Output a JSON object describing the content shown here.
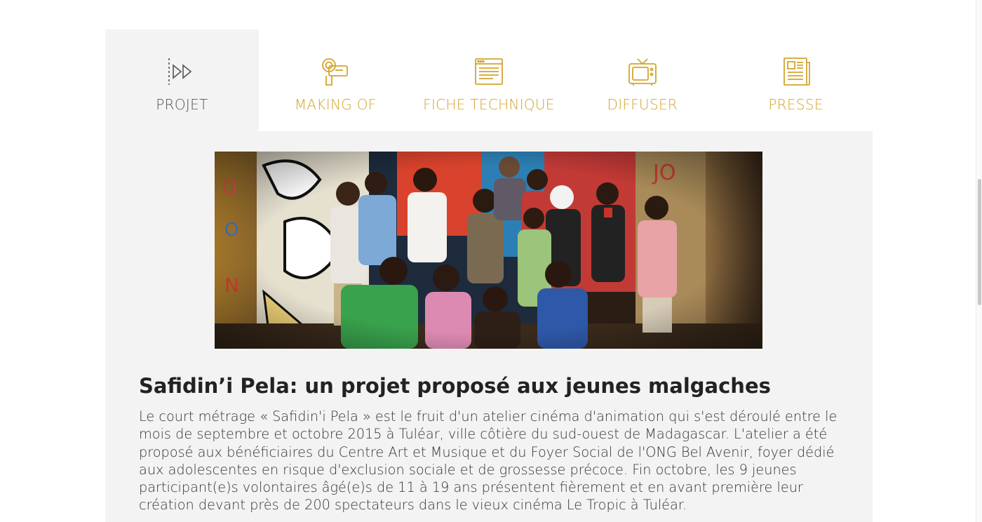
{
  "tabs": [
    {
      "label": "PROJET",
      "icon": "play-forward-icon",
      "active": true
    },
    {
      "label": "MAKING OF",
      "icon": "video-camera-icon",
      "active": false
    },
    {
      "label": "FICHE TECHNIQUE",
      "icon": "browser-page-icon",
      "active": false
    },
    {
      "label": "DIFFUSER",
      "icon": "television-icon",
      "active": false
    },
    {
      "label": "PRESSE",
      "icon": "newspaper-icon",
      "active": false
    }
  ],
  "colors": {
    "accent": "#d3a52d",
    "active_tab_text": "#555555",
    "panel_background": "#f3f3f3",
    "title_text": "#222222",
    "body_text": "#333333"
  },
  "article": {
    "image_icon": "group-photo-image",
    "title": "Safidin’i Pela: un projet proposé aux jeunes malgaches",
    "body": "Le court métrage « Safidin'i Pela » est le fruit d'un atelier cinéma d'animation qui s'est déroulé entre le mois de septembre et octobre 2015 à Tuléar, ville côtière du sud-ouest de Madagascar. L'atelier a été proposé aux bénéficiaires du Centre Art et Musique et du Foyer Social de l'ONG Bel Avenir, foyer dédié aux adolescentes en risque d'exclusion sociale et de grossesse précoce. Fin octobre, les 9 jeunes participant(e)s volontaires âgé(e)s de 11 à 19 ans présentent fièrement et en avant première leur création devant près de 200 spectateurs dans le vieux cinéma Le Tropic à Tuléar."
  }
}
